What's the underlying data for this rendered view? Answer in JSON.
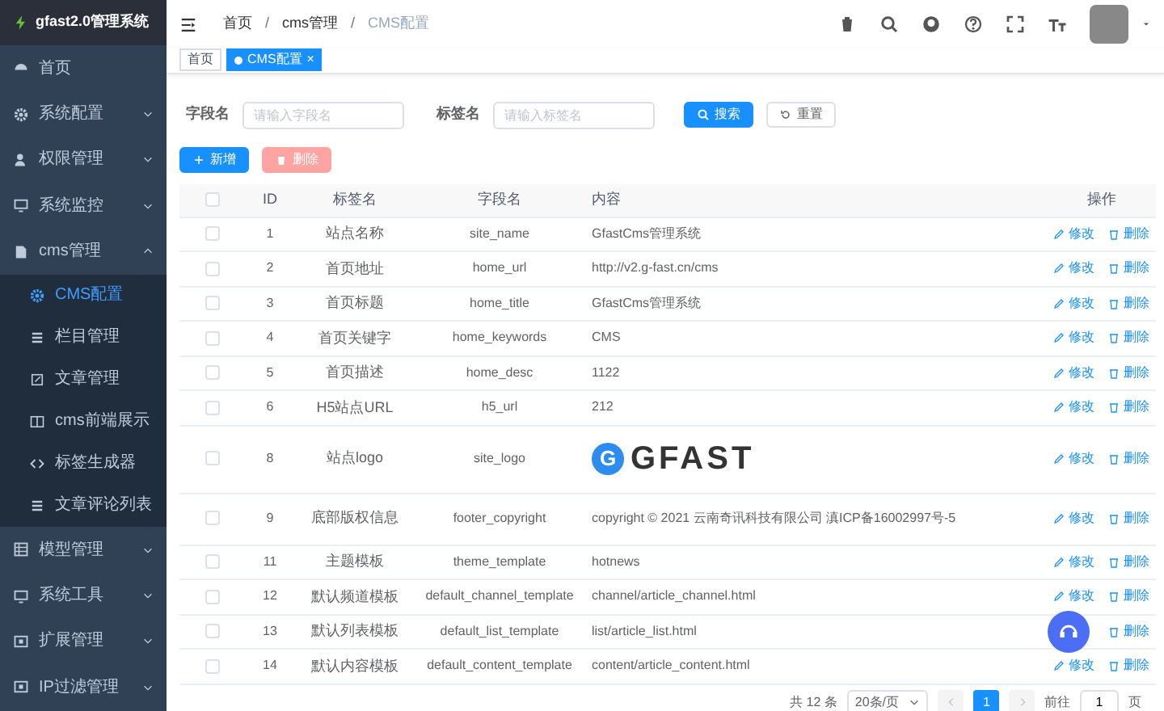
{
  "app": {
    "title": "gfast2.0管理系统"
  },
  "sidebar": {
    "items": [
      {
        "label": "首页",
        "kind": "link"
      },
      {
        "label": "系统配置",
        "kind": "menu",
        "expanded": false
      },
      {
        "label": "权限管理",
        "kind": "menu",
        "expanded": false
      },
      {
        "label": "系统监控",
        "kind": "menu",
        "expanded": false
      },
      {
        "label": "cms管理",
        "kind": "menu",
        "expanded": true,
        "children": [
          {
            "label": "CMS配置",
            "selected": true
          },
          {
            "label": "栏目管理",
            "selected": false
          },
          {
            "label": "文章管理",
            "selected": false
          },
          {
            "label": "cms前端展示",
            "selected": false
          },
          {
            "label": "标签生成器",
            "selected": false
          },
          {
            "label": "文章评论列表",
            "selected": false
          }
        ]
      },
      {
        "label": "模型管理",
        "kind": "menu",
        "expanded": false
      },
      {
        "label": "系统工具",
        "kind": "menu",
        "expanded": false
      },
      {
        "label": "扩展管理",
        "kind": "menu",
        "expanded": false
      },
      {
        "label": "IP过滤管理",
        "kind": "menu",
        "expanded": false
      }
    ]
  },
  "breadcrumb": {
    "items": [
      "首页",
      "cms管理",
      "CMS配置"
    ],
    "separators": [
      "/",
      "/"
    ]
  },
  "tags": [
    {
      "label": "首页",
      "selected": false,
      "closable": false
    },
    {
      "label": "CMS配置",
      "selected": true,
      "closable": true,
      "close_glyph": "×"
    }
  ],
  "search": {
    "fields": [
      {
        "label": "字段名",
        "placeholder": "请输入字段名"
      },
      {
        "label": "标签名",
        "placeholder": "请输入标签名"
      }
    ],
    "search_button": "搜索",
    "reset_button": "重置"
  },
  "toolbar": {
    "add_button": "新增",
    "delete_button": "删除",
    "delete_disabled": true
  },
  "table": {
    "all_checked": false,
    "columns": [
      "ID",
      "标签名",
      "字段名",
      "内容",
      "操作"
    ],
    "rows": [
      {
        "checked": false,
        "id": "1",
        "label": "站点名称",
        "field": "site_name",
        "kind": "text",
        "content": "GfastCms管理系统",
        "actions": [
          {
            "kind": "edit",
            "label": "修改"
          },
          {
            "kind": "delete",
            "label": "删除"
          }
        ]
      },
      {
        "checked": false,
        "id": "2",
        "label": "首页地址",
        "field": "home_url",
        "kind": "text",
        "content": "http://v2.g-fast.cn/cms",
        "actions": [
          {
            "kind": "edit",
            "label": "修改"
          },
          {
            "kind": "delete",
            "label": "删除"
          }
        ]
      },
      {
        "checked": false,
        "id": "3",
        "label": "首页标题",
        "field": "home_title",
        "kind": "text",
        "content": "GfastCms管理系统",
        "actions": [
          {
            "kind": "edit",
            "label": "修改"
          },
          {
            "kind": "delete",
            "label": "删除"
          }
        ]
      },
      {
        "checked": false,
        "id": "4",
        "label": "首页关键字",
        "field": "home_keywords",
        "kind": "text",
        "content": "CMS",
        "actions": [
          {
            "kind": "edit",
            "label": "修改"
          },
          {
            "kind": "delete",
            "label": "删除"
          }
        ]
      },
      {
        "checked": false,
        "id": "5",
        "label": "首页描述",
        "field": "home_desc",
        "kind": "text",
        "content": "1122",
        "actions": [
          {
            "kind": "edit",
            "label": "修改"
          },
          {
            "kind": "delete",
            "label": "删除"
          }
        ]
      },
      {
        "checked": false,
        "id": "6",
        "label": "H5站点URL",
        "field": "h5_url",
        "kind": "text",
        "content": "212",
        "actions": [
          {
            "kind": "edit",
            "label": "修改"
          },
          {
            "kind": "delete",
            "label": "删除"
          }
        ]
      },
      {
        "checked": false,
        "id": "8",
        "label": "站点logo",
        "field": "site_logo",
        "kind": "logo",
        "content": "GFAST",
        "logo_letter": "G",
        "actions": [
          {
            "kind": "edit",
            "label": "修改"
          },
          {
            "kind": "delete",
            "label": "删除"
          }
        ]
      },
      {
        "checked": false,
        "id": "9",
        "label": "底部版权信息",
        "field": "footer_copyright",
        "kind": "text",
        "content": "copyright © 2021 云南奇讯科技有限公司 滇ICP备16002997号-5",
        "actions": [
          {
            "kind": "edit",
            "label": "修改"
          },
          {
            "kind": "delete",
            "label": "删除"
          }
        ]
      },
      {
        "checked": false,
        "id": "11",
        "label": "主题模板",
        "field": "theme_template",
        "kind": "text",
        "content": "hotnews",
        "actions": [
          {
            "kind": "edit",
            "label": "修改"
          },
          {
            "kind": "delete",
            "label": "删除"
          }
        ]
      },
      {
        "checked": false,
        "id": "12",
        "label": "默认频道模板",
        "field": "default_channel_template",
        "kind": "text",
        "content": "channel/article_channel.html",
        "actions": [
          {
            "kind": "edit",
            "label": "修改"
          },
          {
            "kind": "delete",
            "label": "删除"
          }
        ]
      },
      {
        "checked": false,
        "id": "13",
        "label": "默认列表模板",
        "field": "default_list_template",
        "kind": "text",
        "content": "list/article_list.html",
        "actions": [
          {
            "kind": "delete",
            "label": "删除"
          }
        ]
      },
      {
        "checked": false,
        "id": "14",
        "label": "默认内容模板",
        "field": "default_content_template",
        "kind": "text",
        "content": "content/article_content.html",
        "actions": [
          {
            "kind": "edit",
            "label": "修改"
          },
          {
            "kind": "delete",
            "label": "删除"
          }
        ]
      }
    ]
  },
  "pagination": {
    "total": "共 12 条",
    "page_size": "20条/页",
    "pages": [
      {
        "label": "1",
        "selected": true
      }
    ],
    "goto_label": "前往",
    "goto_value": "1",
    "page_suffix": "页"
  }
}
